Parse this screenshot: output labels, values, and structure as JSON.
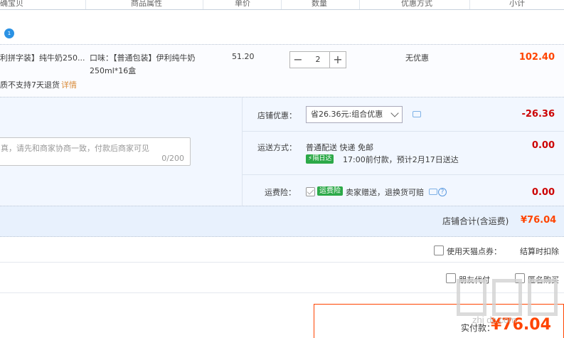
{
  "header": {
    "col_item": "确宝贝",
    "col_attr": "商品属性",
    "col_price": "单价",
    "col_qty": "数量",
    "col_promo": "优惠方式",
    "col_subtotal": "小计"
  },
  "item": {
    "title": "利拼字装】纯牛奶250...",
    "attr": "口味：【普通包装】伊利纯牛奶250ml*16盒",
    "price": "51.20",
    "qty": "2",
    "minus": "−",
    "plus": "+",
    "promo": "无优惠",
    "subtotal": "102.40",
    "note": "质不支持7天退货",
    "detail_link": "详情"
  },
  "shop_promo": {
    "label": "店铺优惠：",
    "selected": "省26.36元:组合优惠",
    "amount": "-26.36"
  },
  "memo": {
    "placeholder": "真，请先和商家协商一致，付款后商家可见",
    "counter": "0/200"
  },
  "shipping": {
    "label": "运送方式：",
    "method": "普通配送 快递 免邮",
    "badge": "隔日达",
    "eta": "17:00前付款，预计2月17日送达",
    "amount": "0.00"
  },
  "insurance": {
    "label": "运费险：",
    "badge": "运费险",
    "text": "卖家赠送，退换货可赔",
    "help": "?",
    "amount": "0.00"
  },
  "shop_total": {
    "label": "店铺合计(含运费)",
    "value": "¥76.04"
  },
  "tmall_points": {
    "label": "使用天猫点券：",
    "value": "结算时扣除"
  },
  "friend_pay": "朋友代付",
  "anonymous": "匿名购买",
  "pay": {
    "label": "实付款：",
    "value": "¥76.04"
  },
  "shop_icon": "1",
  "watermark": "zhi dc.com",
  "colors": {
    "accent": "#ff4400",
    "negative": "#cc0000",
    "panel": "#f2f7ff",
    "green_badge": "#2ca948"
  }
}
